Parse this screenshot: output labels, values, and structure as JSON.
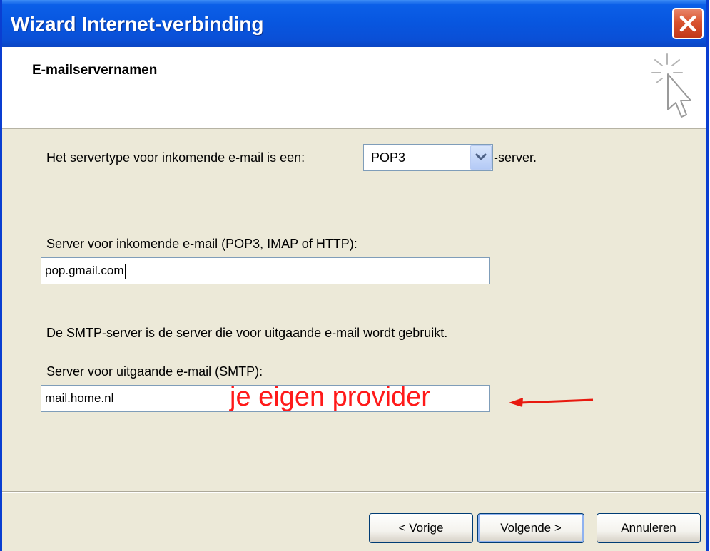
{
  "window": {
    "title": "Wizard Internet-verbinding",
    "close_icon": "close-icon"
  },
  "header": {
    "title": "E-mailservernamen",
    "icon": "wizard-cursor-icon"
  },
  "incoming_type": {
    "label": "Het servertype voor inkomende e-mail is een:",
    "selected": "POP3",
    "suffix": "-server."
  },
  "incoming_server": {
    "label": "Server voor inkomende e-mail (POP3, IMAP of HTTP):",
    "value": "pop.gmail.com"
  },
  "smtp_info": "De SMTP-server is de server die voor uitgaande e-mail wordt gebruikt.",
  "outgoing_server": {
    "label": "Server voor uitgaande e-mail (SMTP):",
    "value": "mail.home.nl"
  },
  "annotation": {
    "text": "je eigen provider",
    "color": "#ff1a1a"
  },
  "buttons": {
    "back": "< Vorige",
    "next": "Volgende >",
    "cancel": "Annuleren"
  }
}
